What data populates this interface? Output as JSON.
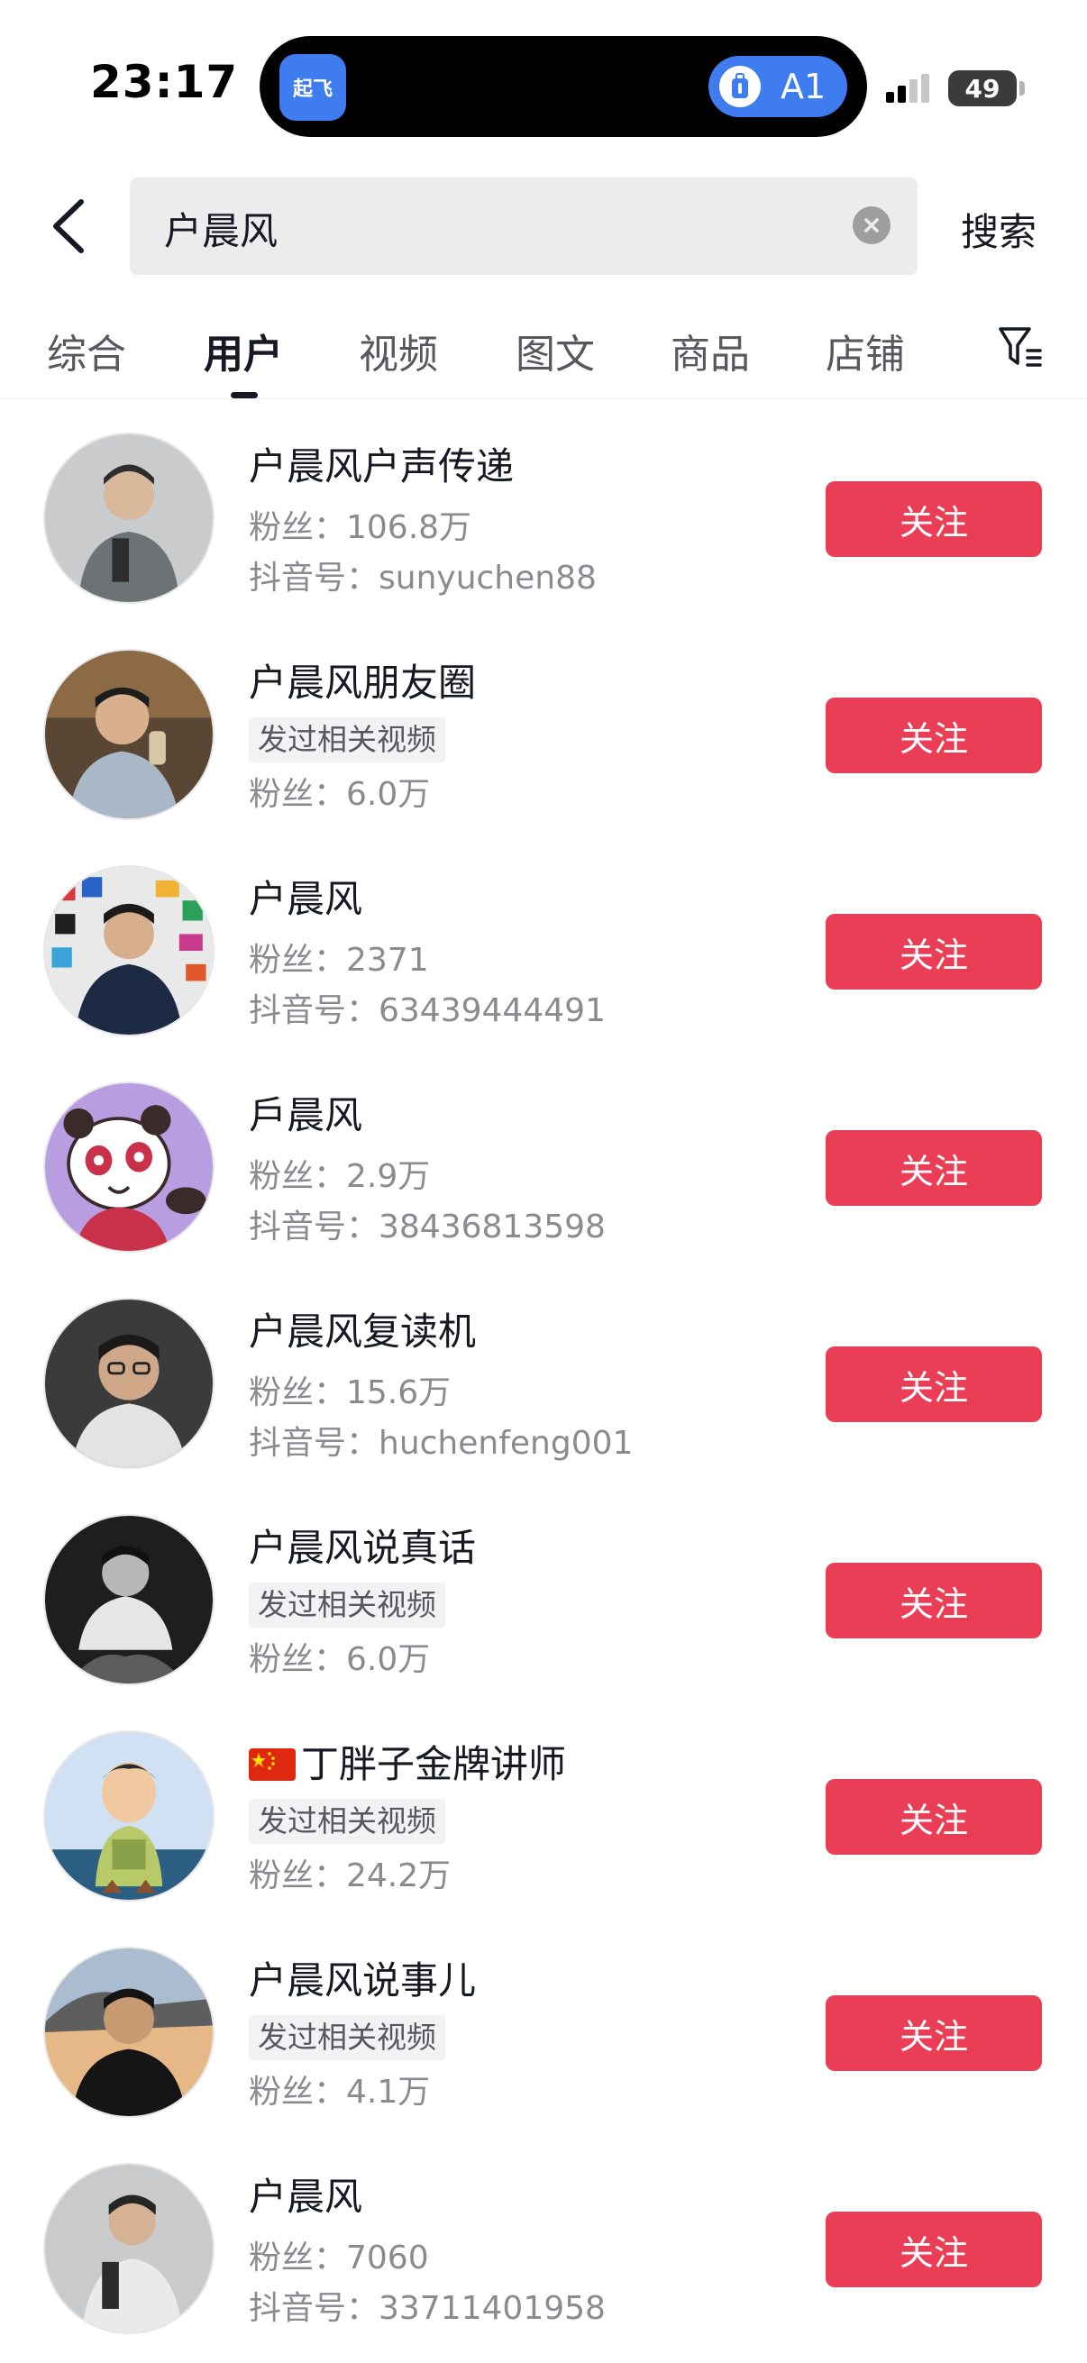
{
  "status_bar": {
    "time": "23:17",
    "island_app_label": "起飞",
    "island_pill_text": "A1",
    "battery": "49"
  },
  "search": {
    "query": "户晨风",
    "submit_label": "搜索"
  },
  "tabs": [
    {
      "label": "综合",
      "active": false
    },
    {
      "label": "用户",
      "active": true
    },
    {
      "label": "视频",
      "active": false
    },
    {
      "label": "图文",
      "active": false
    },
    {
      "label": "商品",
      "active": false
    },
    {
      "label": "店铺",
      "active": false
    }
  ],
  "users": [
    {
      "name": "户晨风户声传递",
      "tag": "",
      "fans": "粉丝：106.8万",
      "douyin_id": "抖音号：sunyuchen88",
      "follow_label": "关注"
    },
    {
      "name": "户晨风朋友圈",
      "tag": "发过相关视频",
      "fans": "粉丝：6.0万",
      "douyin_id": "",
      "follow_label": "关注"
    },
    {
      "name": "户晨风",
      "tag": "",
      "fans": "粉丝：2371",
      "douyin_id": "抖音号：63439444491",
      "follow_label": "关注"
    },
    {
      "name": "戶晨风",
      "tag": "",
      "fans": "粉丝：2.9万",
      "douyin_id": "抖音号：38436813598",
      "follow_label": "关注"
    },
    {
      "name": "户晨风复读机",
      "tag": "",
      "fans": "粉丝：15.6万",
      "douyin_id": "抖音号：huchenfeng001",
      "follow_label": "关注"
    },
    {
      "name": "户晨风说真话",
      "tag": "发过相关视频",
      "fans": "粉丝：6.0万",
      "douyin_id": "",
      "follow_label": "关注"
    },
    {
      "name": "丁胖子金牌讲师",
      "tag": "发过相关视频",
      "fans": "粉丝：24.2万",
      "douyin_id": "",
      "follow_label": "关注",
      "flag": "china-flag-icon"
    },
    {
      "name": "户晨风说事儿",
      "tag": "发过相关视频",
      "fans": "粉丝：4.1万",
      "douyin_id": "",
      "follow_label": "关注"
    },
    {
      "name": "户晨风",
      "tag": "",
      "fans": "粉丝：7060",
      "douyin_id": "抖音号：33711401958",
      "follow_label": "关注"
    }
  ],
  "colors": {
    "follow_button": "#ea3e56",
    "island_accent": "#3e7cf0"
  }
}
